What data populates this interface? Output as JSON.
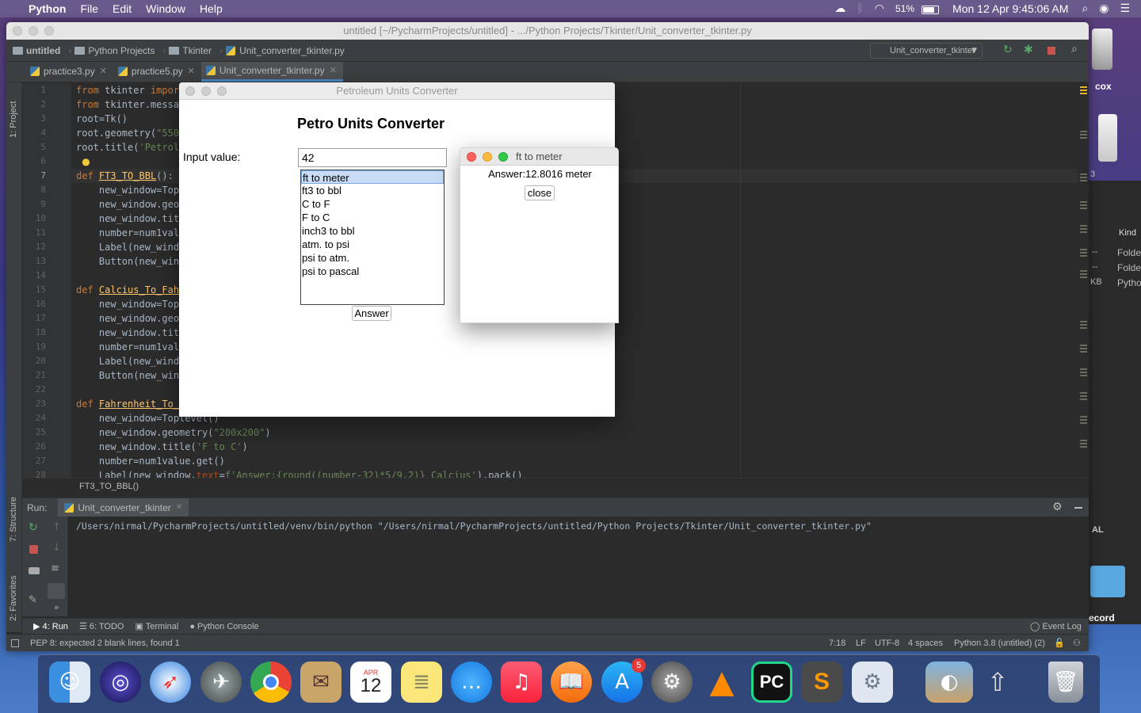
{
  "menubar": {
    "app": "Python",
    "items": [
      "File",
      "Edit",
      "Window",
      "Help"
    ],
    "battery": "51%",
    "clock": "Mon 12 Apr  9:45:06 AM"
  },
  "ide": {
    "title": "untitled [~/PycharmProjects/untitled] - .../Python Projects/Tkinter/Unit_converter_tkinter.py",
    "breadcrumbs": [
      "untitled",
      "Python Projects",
      "Tkinter",
      "Unit_converter_tkinter.py"
    ],
    "run_config": "Unit_converter_tkinter",
    "tabs": [
      "practice3.py",
      "practice5.py",
      "Unit_converter_tkinter.py"
    ],
    "left_tools": [
      "1: Project",
      "7: Structure",
      "2: Favorites"
    ],
    "line_numbers": [
      "1",
      "2",
      "3",
      "4",
      "5",
      "6",
      "7",
      "8",
      "9",
      "10",
      "11",
      "12",
      "13",
      "14",
      "15",
      "16",
      "17",
      "18",
      "19",
      "20",
      "21",
      "22",
      "23",
      "24",
      "25",
      "26",
      "27",
      "28"
    ],
    "code_breadcrumb": "FT3_TO_BBL()",
    "run_label": "Run:",
    "run_tab": "Unit_converter_tkinter",
    "run_command": "/Users/nirmal/PycharmProjects/untitled/venv/bin/python \"/Users/nirmal/PycharmProjects/untitled/Python Projects/Tkinter/Unit_converter_tkinter.py\"",
    "bottom_tabs": [
      "4: Run",
      "6: TODO",
      "Terminal",
      "Python Console"
    ],
    "event_log": "Event Log",
    "status_message": "PEP 8: expected 2 blank lines, found 1",
    "status_right": [
      "7:18",
      "LF",
      "UTF-8",
      "4 spaces",
      "Python 3.8 (untitled) (2)"
    ]
  },
  "desktop": {
    "right_labels": [
      "cox",
      "3",
      "Kind",
      "--",
      "Folde",
      "--",
      "Folde",
      "KB",
      "Pytho",
      "AL",
      "ecord"
    ]
  },
  "tk_main": {
    "title": "Petroleum Units Converter",
    "heading": "Petro Units Converter",
    "input_label": "Input value:",
    "input_value": "42",
    "options": [
      "ft to meter",
      "ft3 to bbl",
      "C to F",
      "F to C",
      "inch3 to bbl",
      "atm. to psi",
      "psi to atm.",
      "psi to pascal"
    ],
    "selected_index": 0,
    "answer_button": "Answer"
  },
  "tk_sub": {
    "title": "ft to meter",
    "answer": "Answer:12.8016 meter",
    "close_button": "close"
  },
  "dock": {
    "calendar_month": "APR",
    "calendar_day": "12",
    "appstore_badge": "5"
  }
}
